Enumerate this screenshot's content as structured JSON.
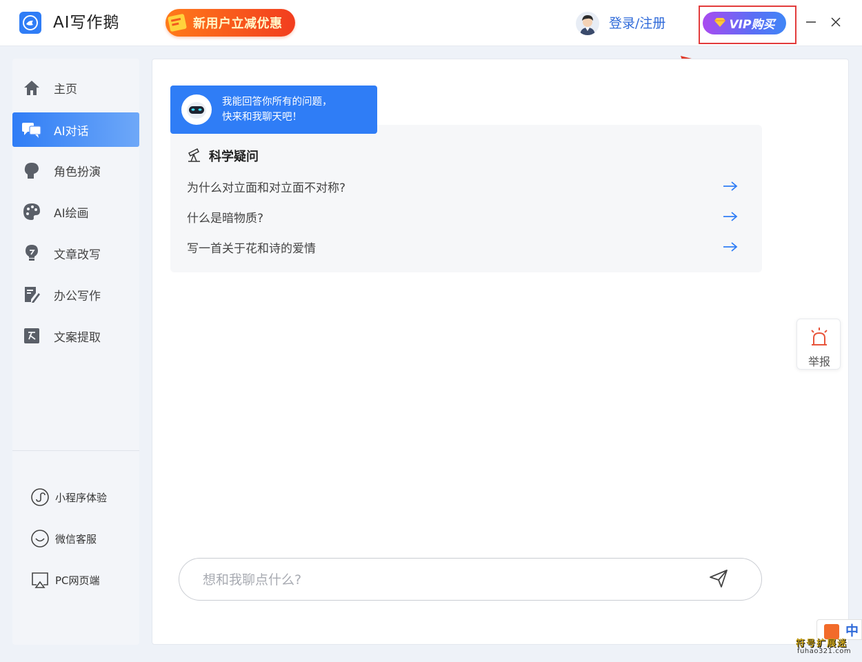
{
  "app": {
    "title": "AI写作鹅"
  },
  "header": {
    "promo_label": "新用户立减优惠",
    "login_label": "登录/注册",
    "vip_label": "VIP购买"
  },
  "sidebar": {
    "items": [
      {
        "label": "主页",
        "icon": "home-icon",
        "active": false
      },
      {
        "label": "AI对话",
        "icon": "chat-icon",
        "active": true
      },
      {
        "label": "角色扮演",
        "icon": "role-play-icon",
        "active": false
      },
      {
        "label": "AI绘画",
        "icon": "palette-icon",
        "active": false
      },
      {
        "label": "文章改写",
        "icon": "lightbulb-icon",
        "active": false
      },
      {
        "label": "办公写作",
        "icon": "edit-icon",
        "active": false
      },
      {
        "label": "文案提取",
        "icon": "text-extract-icon",
        "active": false
      }
    ],
    "extras": [
      {
        "label": "小程序体验",
        "icon": "mini-program-icon"
      },
      {
        "label": "微信客服",
        "icon": "wechat-service-icon"
      },
      {
        "label": "PC网页端",
        "icon": "desktop-web-icon"
      }
    ]
  },
  "chat": {
    "greeting_line1": "我能回答你所有的问题，",
    "greeting_line2": "快来和我聊天吧！",
    "category_title": "科学疑问",
    "questions": [
      "为什么对立面和对立面不对称?",
      "什么是暗物质?",
      "写一首关于花和诗的爱情"
    ],
    "input_placeholder": "想和我聊点什么?"
  },
  "report": {
    "label": "举报"
  },
  "watermark": {
    "zh": "中",
    "text": "符号扩展迷",
    "url": "fuhao321.com"
  },
  "colors": {
    "accent": "#2f7df6",
    "highlight": "#e23b3b"
  }
}
